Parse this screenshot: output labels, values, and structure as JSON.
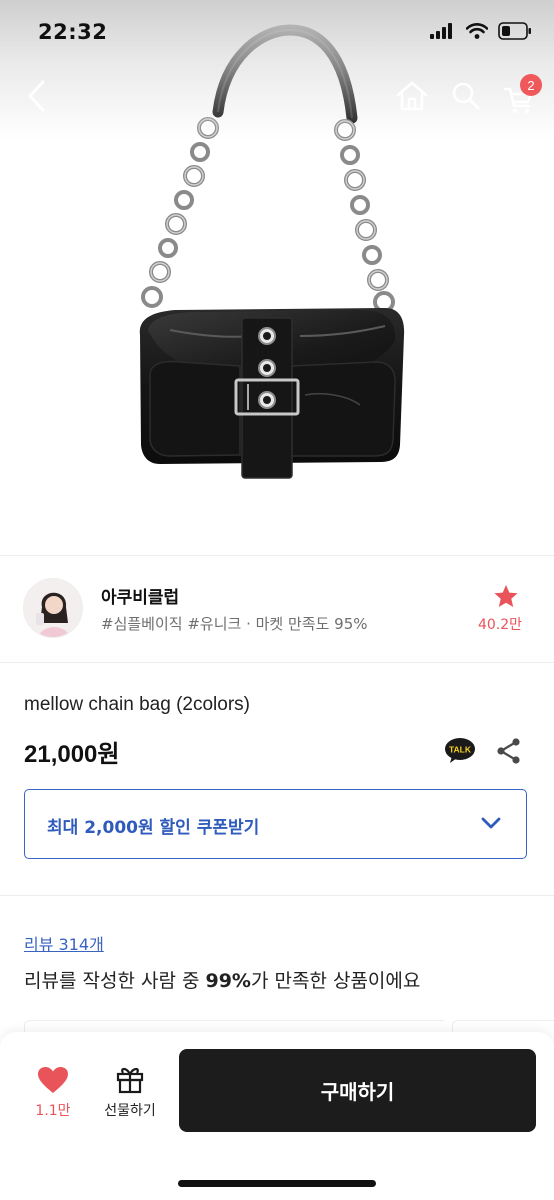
{
  "status_bar": {
    "time": "22:32"
  },
  "nav": {
    "cart_count": "2",
    "icons": [
      "back-chevron-icon",
      "home-icon",
      "search-icon",
      "cart-icon"
    ]
  },
  "seller": {
    "name": "아쿠비클럽",
    "tags": "#심플베이직 #유니크 · 마켓 만족도 95%",
    "favorite_count": "40.2만"
  },
  "product": {
    "title": "mellow chain bag (2colors)",
    "price": "21,000원",
    "talk_badge": "TALK"
  },
  "coupon": {
    "label": "최대 2,000원 할인 쿠폰받기"
  },
  "reviews": {
    "link_label": "리뷰 314개",
    "summary_prefix": "리뷰를 작성한 사람 중 ",
    "summary_highlight": "99%",
    "summary_suffix": "가 만족한 상품이에요"
  },
  "bottom_bar": {
    "like_count": "1.1만",
    "gift_label": "선물하기",
    "buy_label": "구매하기"
  },
  "colors": {
    "accent_blue": "#2f5bbd",
    "like_red": "#e9545a",
    "buy_button": "#1c1c1c"
  }
}
